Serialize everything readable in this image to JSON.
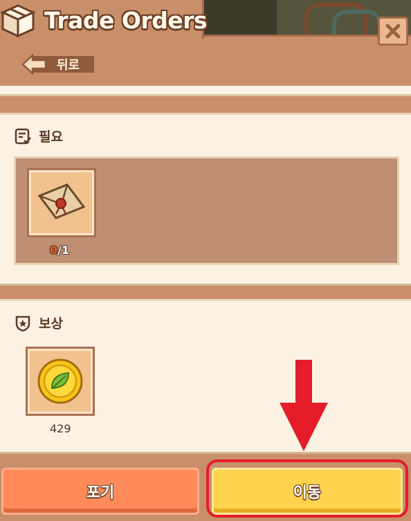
{
  "header": {
    "title": "Trade Orders",
    "back_label": "뒤로"
  },
  "requirements": {
    "section_label": "필요",
    "items": [
      {
        "icon": "sealed-letter-icon",
        "have": "0",
        "need": "/1"
      }
    ]
  },
  "rewards": {
    "section_label": "보상",
    "items": [
      {
        "icon": "leaf-coin-icon",
        "amount": "429"
      }
    ]
  },
  "buttons": {
    "give_up": "포기",
    "move": "이동"
  },
  "colors": {
    "panel": "#c98f6a",
    "card": "#fbf2e4",
    "give_up": "#ff8a5a",
    "move": "#ffd34e",
    "highlight": "#e51d2a"
  }
}
